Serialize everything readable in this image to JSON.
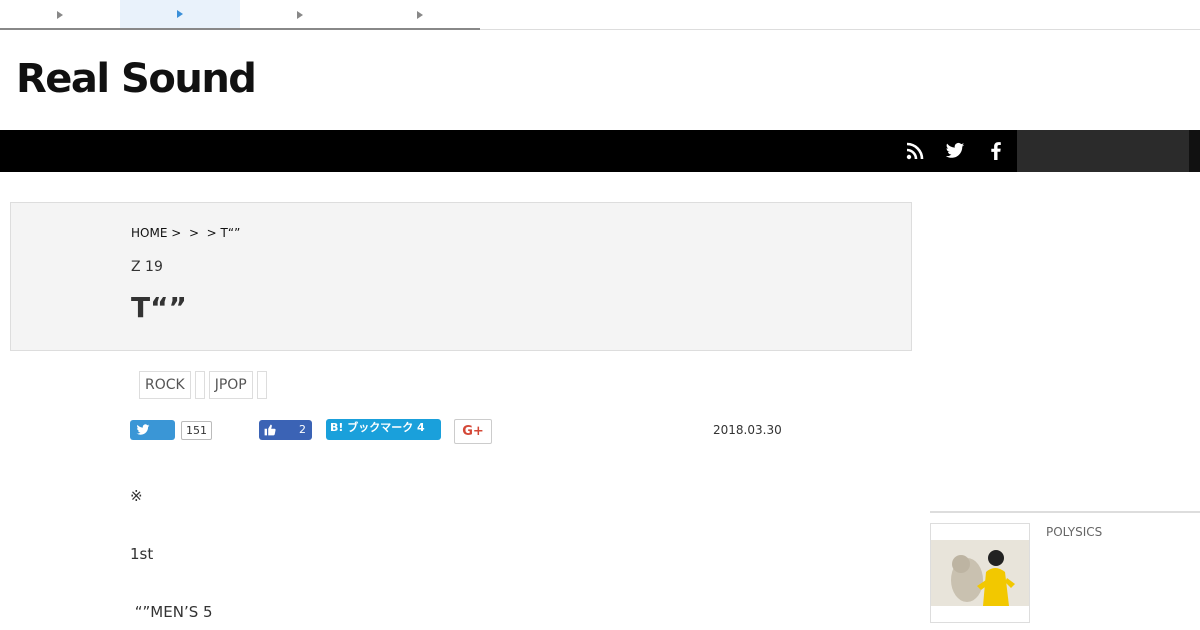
{
  "top_tabs": [
    "",
    "",
    "",
    ""
  ],
  "site": {
    "logo": "Real Sound"
  },
  "social_bar": {
    "icons": [
      "rss-icon",
      "twitter-icon",
      "facebook-icon"
    ],
    "search_value": ""
  },
  "breadcrumb": {
    "home": "HOME",
    "sep": ">",
    "current": "T“”"
  },
  "article": {
    "subhead": "Z 19",
    "title": "T“”",
    "tags": [
      "ROCK",
      "",
      "JPOP",
      ""
    ],
    "share": {
      "tweet_count": "151",
      "like_count": "2",
      "hatena_label": "B! ブックマーク 4",
      "gplus_label": "G+"
    },
    "date": "2018.03.30",
    "paragraphs": [
      "※",
      "1st",
      " “”MEN’S 5"
    ]
  },
  "sidebar": {
    "label": "POLYSICS"
  },
  "colors": {
    "twitter": "#3a96d6",
    "facebook": "#3b63b5",
    "hatena": "#1aa0db",
    "gplus": "#d44837",
    "bar": "#000000"
  }
}
